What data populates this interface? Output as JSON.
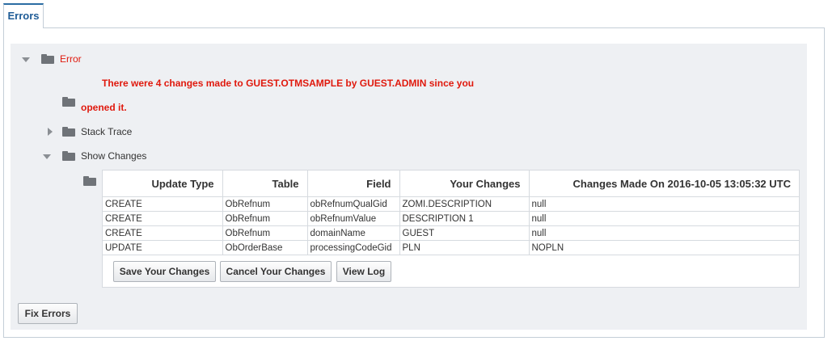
{
  "tabs": [
    {
      "label": "Errors"
    }
  ],
  "tree": {
    "error_label": "Error",
    "message_line1": "There were 4 changes made to GUEST.OTMSAMPLE by GUEST.ADMIN since you",
    "message_line2": "opened it.",
    "stack_trace_label": "Stack Trace",
    "show_changes_label": "Show Changes"
  },
  "changes_table": {
    "headers": [
      "Update Type",
      "Table",
      "Field",
      "Your Changes",
      "Changes Made On 2016-10-05 13:05:32 UTC"
    ],
    "rows": [
      [
        "CREATE",
        "ObRefnum",
        "obRefnumQualGid",
        "ZOMI.DESCRIPTION",
        "null"
      ],
      [
        "CREATE",
        "ObRefnum",
        "obRefnumValue",
        "DESCRIPTION 1",
        "null"
      ],
      [
        "CREATE",
        "ObRefnum",
        "domainName",
        "GUEST",
        "null"
      ],
      [
        "UPDATE",
        "ObOrderBase",
        "processingCodeGid",
        "PLN",
        "NOPLN"
      ]
    ]
  },
  "buttons": {
    "save": "Save Your Changes",
    "cancel": "Cancel Your Changes",
    "view_log": "View Log",
    "fix_errors": "Fix Errors"
  },
  "icons": [
    "expand-triangle-icon",
    "collapse-triangle-icon",
    "folder-icon"
  ],
  "colors": {
    "accent": "#2b6ca3",
    "error": "#e0190d",
    "panel": "#eef0f3"
  }
}
